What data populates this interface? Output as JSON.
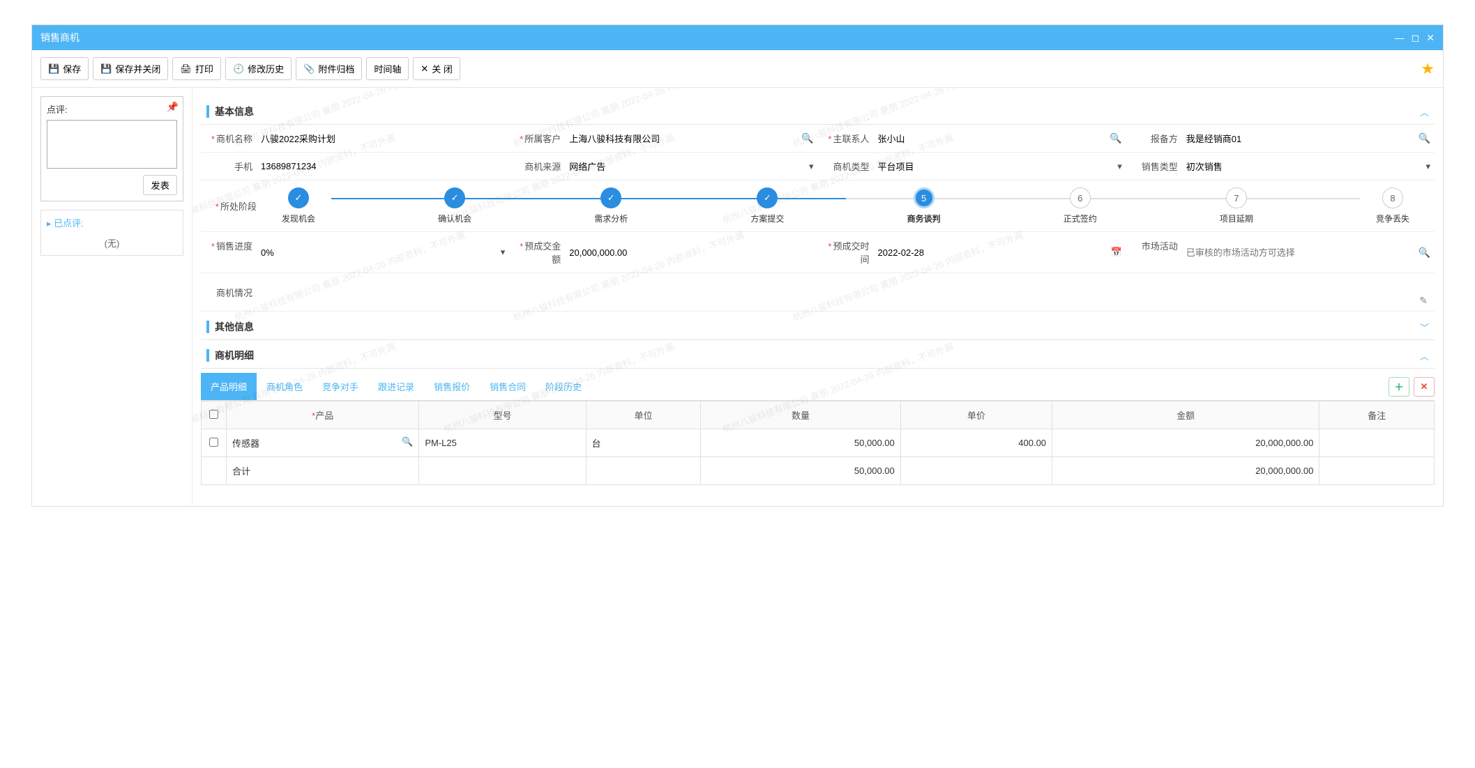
{
  "window": {
    "title": "销售商机"
  },
  "toolbar": {
    "save": "保存",
    "save_close": "保存并关闭",
    "print": "打印",
    "history": "修改历史",
    "attach": "附件归档",
    "timeline": "时间轴",
    "close": "关 闭"
  },
  "comment": {
    "label": "点评:",
    "publish": "发表",
    "list_header": "▸ 已点评:",
    "none": "(无)"
  },
  "sections": {
    "basic": "基本信息",
    "other": "其他信息",
    "detail": "商机明细"
  },
  "fields": {
    "name": {
      "label": "商机名称",
      "value": "八骏2022采购计划"
    },
    "customer": {
      "label": "所属客户",
      "value": "上海八骏科技有限公司"
    },
    "main_contact": {
      "label": "主联系人",
      "value": "张小山"
    },
    "reporter": {
      "label": "报备方",
      "value": "我是经销商01"
    },
    "phone": {
      "label": "手机",
      "value": "13689871234"
    },
    "source": {
      "label": "商机来源",
      "value": "网络广告"
    },
    "type": {
      "label": "商机类型",
      "value": "平台项目"
    },
    "sale_type": {
      "label": "销售类型",
      "value": "初次销售"
    },
    "stage_label": "所处阶段",
    "progress": {
      "label": "销售进度",
      "value": "0%"
    },
    "expected_amount": {
      "label": "预成交金额",
      "value": "20,000,000.00"
    },
    "expected_time": {
      "label": "预成交时间",
      "value": "2022-02-28"
    },
    "market": {
      "label": "市场活动",
      "placeholder": "已审核的市场活动方可选择"
    },
    "situation": {
      "label": "商机情况"
    }
  },
  "stages": [
    {
      "label": "发现机会",
      "state": "done"
    },
    {
      "label": "确认机会",
      "state": "done"
    },
    {
      "label": "需求分析",
      "state": "done"
    },
    {
      "label": "方案提交",
      "state": "done"
    },
    {
      "label": "商务谈判",
      "state": "current",
      "num": "5"
    },
    {
      "label": "正式签约",
      "state": "todo",
      "num": "6"
    },
    {
      "label": "项目延期",
      "state": "todo",
      "num": "7"
    },
    {
      "label": "竞争丢失",
      "state": "todo",
      "num": "8"
    }
  ],
  "tabs": [
    "产品明细",
    "商机角色",
    "竞争对手",
    "跟进记录",
    "销售报价",
    "销售合同",
    "阶段历史"
  ],
  "grid": {
    "headers": {
      "product": "产品",
      "model": "型号",
      "unit": "单位",
      "qty": "数量",
      "price": "单价",
      "amount": "金额",
      "remark": "备注"
    },
    "rows": [
      {
        "product": "传感器",
        "model": "PM-L25",
        "unit": "台",
        "qty": "50,000.00",
        "price": "400.00",
        "amount": "20,000,000.00",
        "remark": ""
      }
    ],
    "total": {
      "label": "合计",
      "qty": "50,000.00",
      "amount": "20,000,000.00"
    }
  },
  "watermark": "杭州八骏科技有限公司 襄朋 2022-04-26 内部资料，不可外漏"
}
